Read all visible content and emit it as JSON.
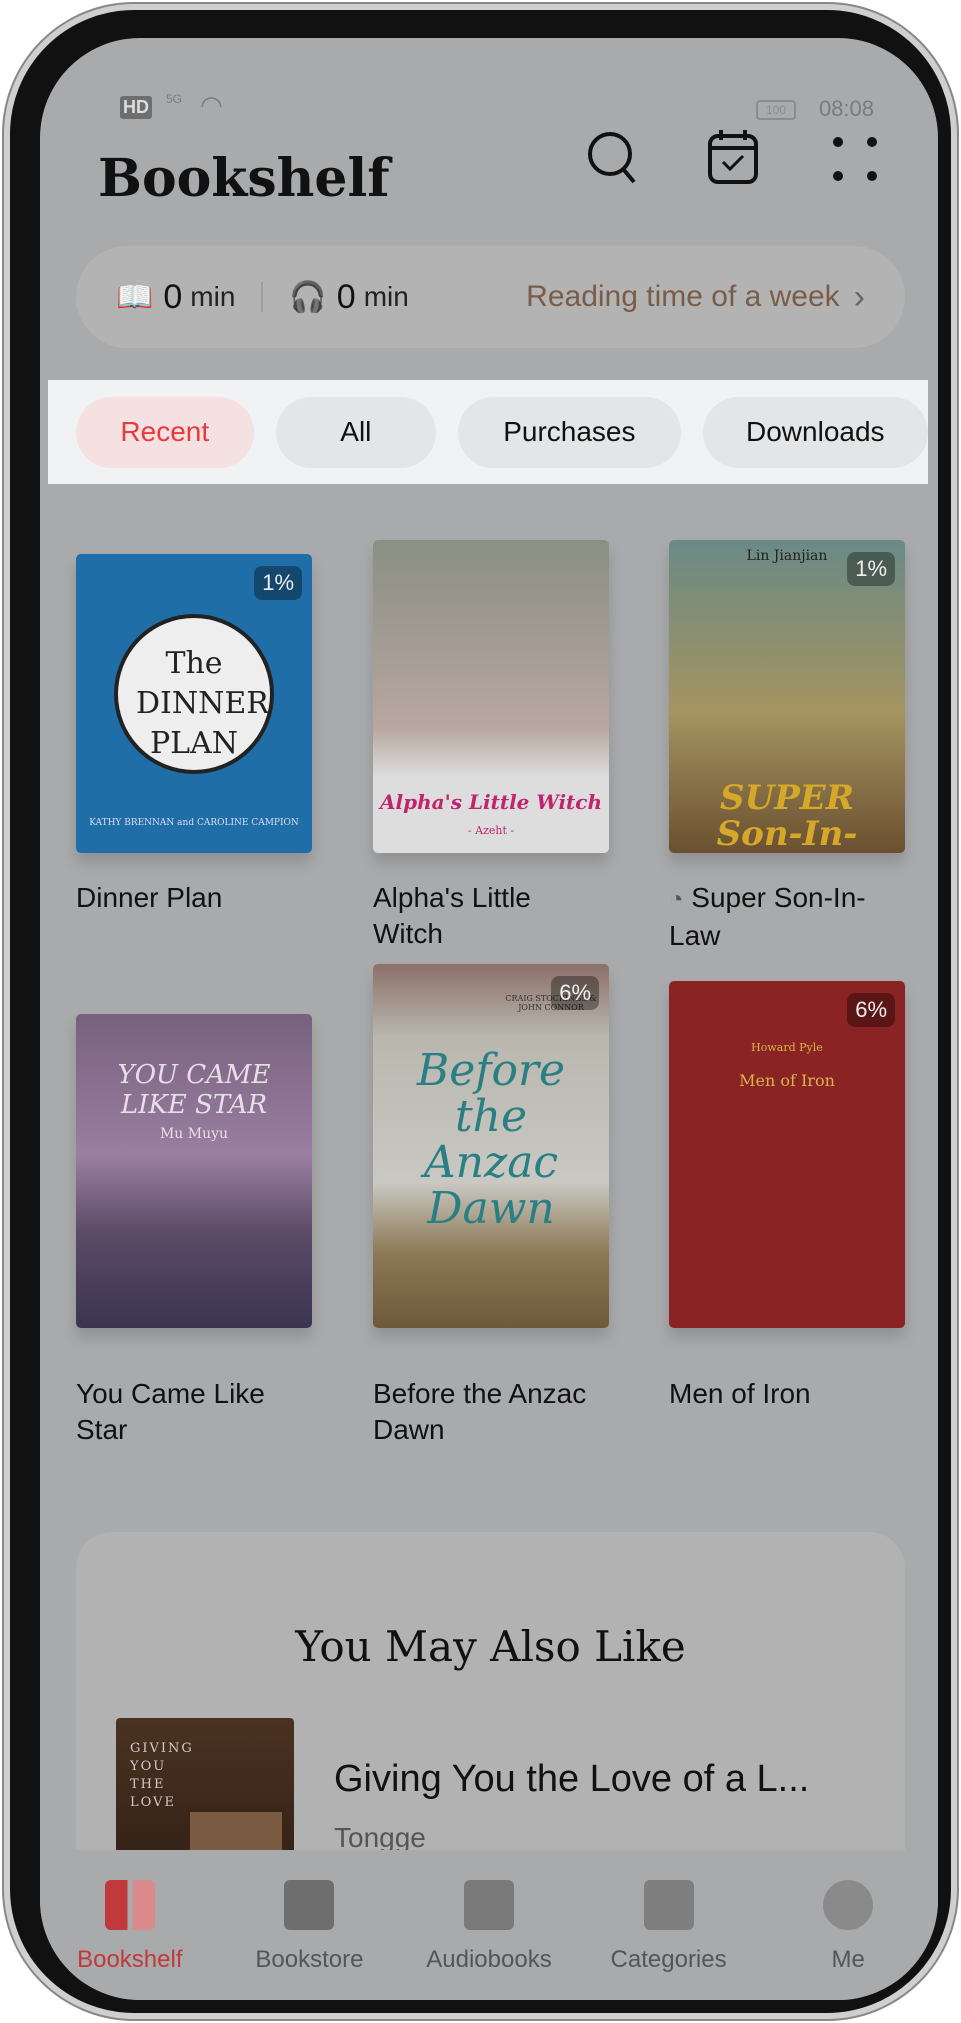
{
  "status": {
    "network": "HD",
    "signal": "5G",
    "battery": "100",
    "time": "08:08"
  },
  "header": {
    "title": "Bookshelf",
    "icons": [
      "search-icon",
      "calendar-check-icon",
      "more-grid-icon"
    ]
  },
  "reading": {
    "read_value": "0",
    "read_unit": "min",
    "listen_value": "0",
    "listen_unit": "min",
    "week_label": "Reading time of a week"
  },
  "tabs": [
    {
      "label": "Recent",
      "active": true
    },
    {
      "label": "All"
    },
    {
      "label": "Purchases"
    },
    {
      "label": "Downloads"
    }
  ],
  "books": [
    {
      "title": "Dinner Plan",
      "progress": "1%",
      "cover_text": "The DINNER PLAN",
      "cover_sub": "KATHY BRENNAN and CAROLINE CAMPION"
    },
    {
      "title": "Alpha's Little Witch",
      "progress": "",
      "cover_text": "Alpha's Little Witch",
      "cover_sub": "- Azeht -"
    },
    {
      "title": "Super Son-In-Law",
      "progress": "1%",
      "cover_text": "SUPER Son-In-Law",
      "cover_sub": "Lin Jianjian"
    },
    {
      "title": "You Came Like Star",
      "progress": "",
      "cover_text": "YOU CAME LIKE STAR",
      "cover_sub": "Mu Muyu"
    },
    {
      "title": "Before the Anzac Dawn",
      "progress": "6%",
      "cover_text": "Before the Anzac Dawn",
      "cover_sub": "CRAIG STOCKINGS & JOHN CONNOR"
    },
    {
      "title": "Men of Iron",
      "progress": "6%",
      "cover_text": "Men of Iron",
      "cover_sub": "Howard Pyle"
    }
  ],
  "recommend": {
    "heading": "You May Also Like",
    "item": {
      "title": "Giving You the Love of a L...",
      "author": "Tongge",
      "cover_text": "GIVING YOU THE LOVE"
    }
  },
  "nav": [
    {
      "label": "Bookshelf",
      "active": true
    },
    {
      "label": "Bookstore"
    },
    {
      "label": "Audiobooks"
    },
    {
      "label": "Categories"
    },
    {
      "label": "Me"
    }
  ],
  "colors": {
    "accent": "#e8393d",
    "week_link": "#7a5c48"
  }
}
